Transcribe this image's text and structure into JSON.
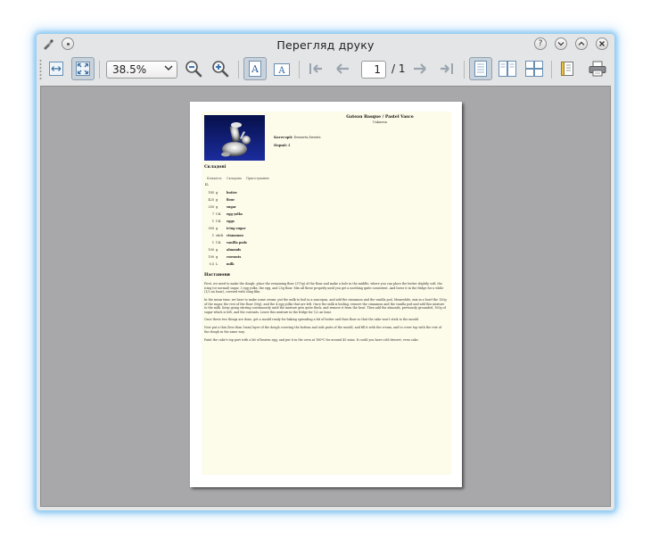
{
  "window": {
    "title": "Перегляд друку",
    "controls": {
      "help": "?",
      "minimize": "⌄",
      "maximize": "⌃",
      "close": "✕"
    }
  },
  "toolbar": {
    "zoom_value": "38.5%",
    "page_current": "1",
    "page_total": "/ 1"
  },
  "document": {
    "title": "Gateau Basque / Pastel Vasco",
    "subtitle": "Unknown",
    "category_label": "Категорії:",
    "category_value": "Desserts,Sweets",
    "servings_label": "Порції:",
    "servings_value": "4",
    "ingredients_heading": "Складові",
    "ingredient_columns": [
      "Кількість",
      "Складова",
      "Приготування"
    ],
    "unit_group": "U.",
    "ingredients": [
      {
        "amount": "185",
        "unit": "g",
        "food": "butter"
      },
      {
        "amount": "425",
        "unit": "g",
        "food": "flour"
      },
      {
        "amount": "250",
        "unit": "g",
        "food": "sugar"
      },
      {
        "amount": "7",
        "unit": "Ud.",
        "food": "egg yolks"
      },
      {
        "amount": "1",
        "unit": "Ud.",
        "food": "eggs"
      },
      {
        "amount": "300",
        "unit": "g",
        "food": "icing sugar"
      },
      {
        "amount": "1",
        "unit": "stick",
        "food": "cinnamon"
      },
      {
        "amount": "1",
        "unit": "Ud.",
        "food": "vanilla pods"
      },
      {
        "amount": "100",
        "unit": "g",
        "food": "almonds"
      },
      {
        "amount": "100",
        "unit": "g",
        "food": "currants"
      },
      {
        "amount": "0,5",
        "unit": "L",
        "food": "milk"
      }
    ],
    "instructions_heading": "Настанови",
    "instructions": [
      "First, we need to make the dough: place the remaining flour (375g) of the flour and make a hole in the middle, where you can place the butter slightly soft, the icing (or normal) sugar, 3 egg yolks, the egg, and 25g flour. Mix all these properly until you get a soothing quite consistent. And leave it in the fridge for a while (1/2 an hour), covered with cling film.",
      "In the mean time, we have to make some cream: put the milk to boil in a saucepan, and add the cinnamon and the vanilla pod. Meanwhile, mix in a bowl the 150g of the sugar, the rest of the flour (50g), and the 4 egg yolks that are left. Once the milk is boiling, remove the cinnamon and the vanilla pod and add this mixture to the milk. Keep going stirring continuously until the mixture gets quite thick, and remove it from the heat. Then add the almonds, previously grounded, 100g of sugar which is left, and the currants. Leave this mixture in the fridge for 1/2 an hour.",
      "Once these two things are done, get a mould ready for baking spreading a bit of butter and then flour so that the cake won't stick to the mould.",
      "Now put a thin (less than 5mm) layer of the dough covering the bottom and side parts of the mould, and fill it with the cream, and to cover top with the rest of the dough in the same way.",
      "Paint the cake's top part with a bit of beaten egg, and put it in the oven at 180ºC for around 45 mins. It could you have cold dessert, even cake."
    ]
  }
}
